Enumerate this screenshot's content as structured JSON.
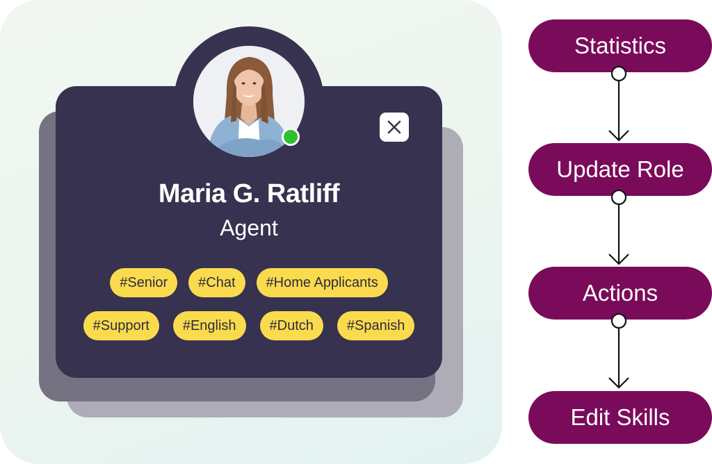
{
  "profile_card": {
    "name": "Maria G. Ratliff",
    "role": "Agent",
    "status": "online",
    "status_color": "#2ec02e",
    "close_icon": "close-icon",
    "tags_row1": [
      "#Senior",
      "#Chat",
      "#Home Applicants"
    ],
    "tags_row2": [
      "#Support",
      "#English",
      "#Dutch",
      "#Spanish"
    ],
    "colors": {
      "card": "#36324f",
      "tag": "#fadb4e",
      "tag_text": "#2e2b3f"
    }
  },
  "flow": {
    "node_color": "#7a0b5a",
    "nodes": [
      {
        "label": "Statistics"
      },
      {
        "label": "Update Role"
      },
      {
        "label": "Actions"
      },
      {
        "label": "Edit Skills"
      }
    ]
  }
}
